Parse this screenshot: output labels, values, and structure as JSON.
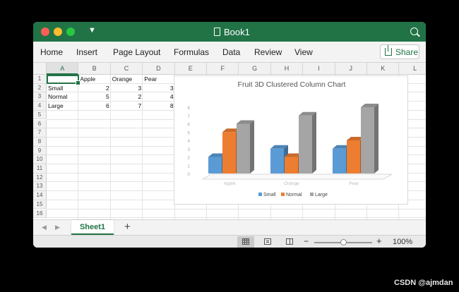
{
  "window": {
    "title": "Book1"
  },
  "ribbon": {
    "tabs": [
      "Home",
      "Insert",
      "Page Layout",
      "Formulas",
      "Data",
      "Review",
      "View"
    ],
    "share_label": "Share"
  },
  "sheet": {
    "columns": [
      "A",
      "B",
      "C",
      "D",
      "E",
      "F",
      "G",
      "H",
      "I",
      "J",
      "K",
      "L"
    ],
    "rows": [
      "1",
      "2",
      "3",
      "4",
      "5",
      "6",
      "7",
      "8",
      "9",
      "10",
      "11",
      "12",
      "13",
      "14",
      "15",
      "16"
    ],
    "active_cell": "A1",
    "cells": [
      [
        "",
        "Apple",
        "Orange",
        "Pear"
      ],
      [
        "Small",
        "2",
        "3",
        "3"
      ],
      [
        "Normal",
        "5",
        "2",
        "4"
      ],
      [
        "Large",
        "6",
        "7",
        "8"
      ]
    ]
  },
  "chart_data": {
    "type": "bar",
    "title": "Fruit 3D Clustered Column Chart",
    "categories": [
      "Apple",
      "Orange",
      "Pear"
    ],
    "series": [
      {
        "name": "Small",
        "values": [
          2,
          3,
          3
        ],
        "color": "#5b9bd5"
      },
      {
        "name": "Normal",
        "values": [
          5,
          2,
          4
        ],
        "color": "#ed7d31"
      },
      {
        "name": "Large",
        "values": [
          6,
          7,
          8
        ],
        "color": "#a5a5a5"
      }
    ],
    "ylim": [
      0,
      8
    ],
    "y_ticks": [
      "0",
      "1",
      "2",
      "3",
      "4",
      "5",
      "6",
      "7",
      "8"
    ],
    "legend_position": "bottom"
  },
  "tabs": {
    "sheets": [
      "Sheet1"
    ],
    "add_label": "+"
  },
  "status": {
    "zoom_label": "100%",
    "zoom_fraction": 0.5,
    "minus": "−",
    "plus": "+"
  },
  "watermark": "CSDN @ajmdan",
  "icons": [
    "close-icon",
    "minimize-icon",
    "zoom-icon",
    "quick-access-icon",
    "document-icon",
    "search-icon",
    "share-icon"
  ],
  "colors": {
    "accent": "#217346",
    "red": "#ff5f57",
    "yellow": "#febc2e",
    "green": "#28c840"
  }
}
